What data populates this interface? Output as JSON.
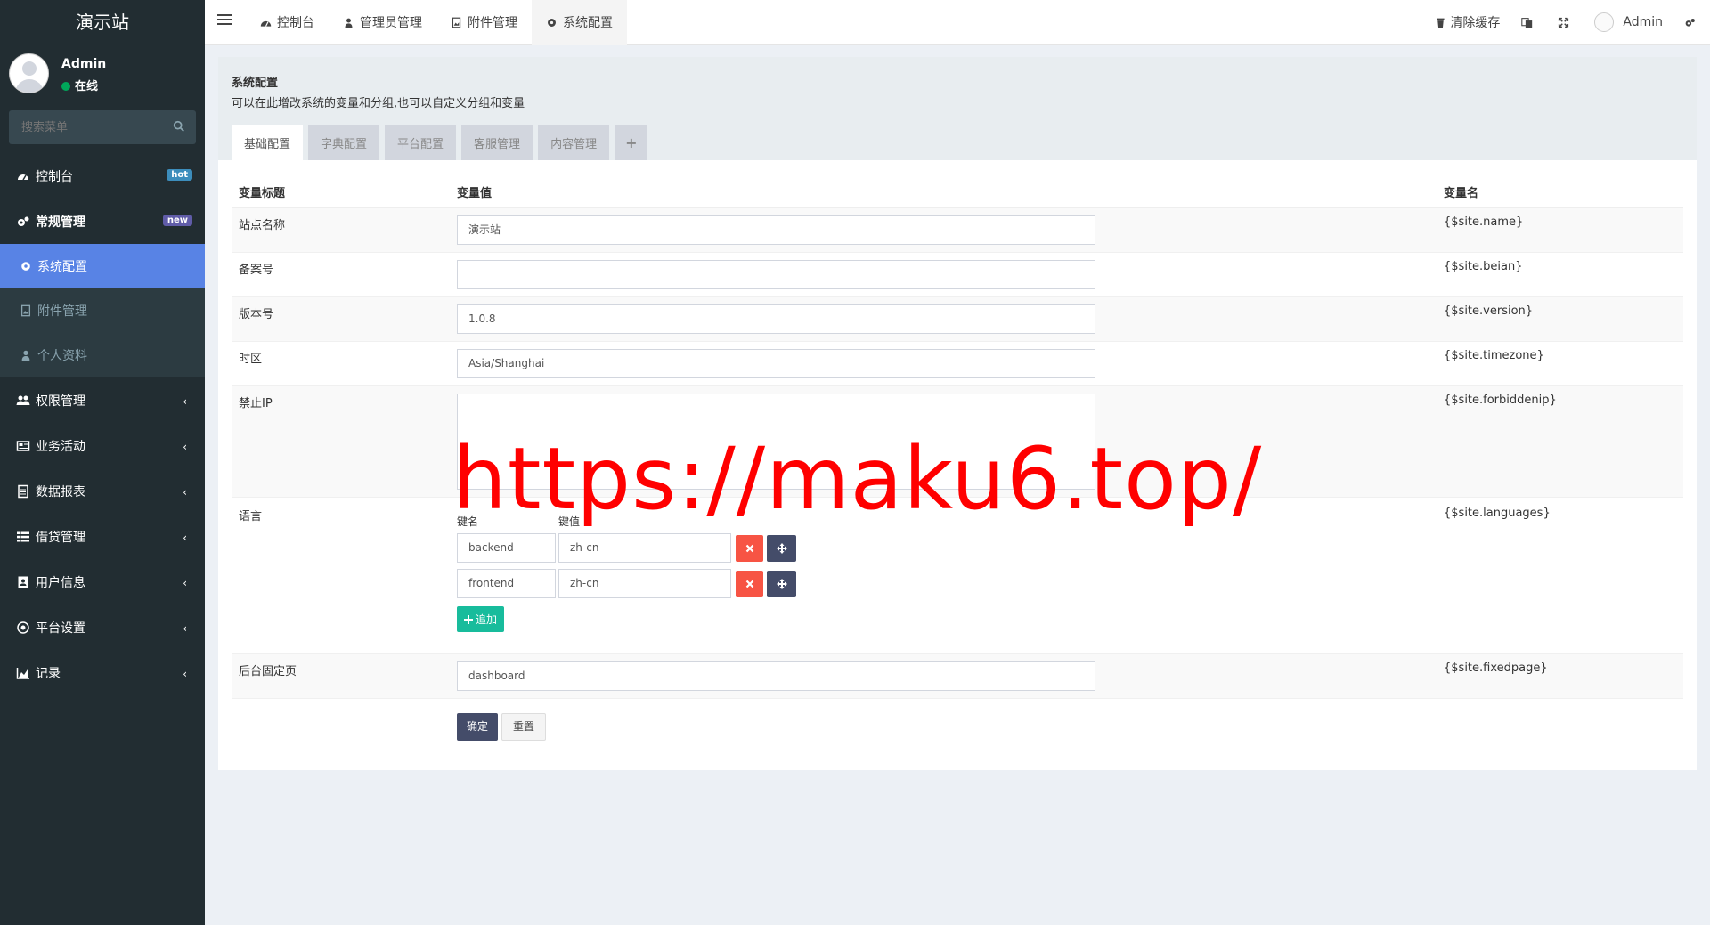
{
  "sidebar": {
    "logo": "演示站",
    "user": {
      "name": "Admin",
      "status": "在线"
    },
    "search": {
      "placeholder": "搜索菜单"
    },
    "menu": [
      {
        "label": "控制台",
        "badge": "hot"
      },
      {
        "label": "常规管理",
        "badge": "new"
      },
      {
        "label": "权限管理",
        "chevron": "‹"
      },
      {
        "label": "业务活动",
        "chevron": "‹"
      },
      {
        "label": "数据报表",
        "chevron": "‹"
      },
      {
        "label": "借贷管理",
        "chevron": "‹"
      },
      {
        "label": "用户信息",
        "chevron": "‹"
      },
      {
        "label": "平台设置",
        "chevron": "‹"
      },
      {
        "label": "记录",
        "chevron": "‹"
      }
    ],
    "submenu": [
      {
        "label": "系统配置"
      },
      {
        "label": "附件管理"
      },
      {
        "label": "个人资料"
      }
    ]
  },
  "topnav": {
    "tabs": [
      {
        "label": "控制台"
      },
      {
        "label": "管理员管理"
      },
      {
        "label": "附件管理"
      },
      {
        "label": "系统配置"
      }
    ],
    "clear_cache": "清除缓存",
    "admin": "Admin"
  },
  "panel": {
    "title": "系统配置",
    "description": "可以在此增改系统的变量和分组,也可以自定义分组和变量",
    "tabs": [
      "基础配置",
      "字典配置",
      "平台配置",
      "客服管理",
      "内容管理",
      "+"
    ]
  },
  "table": {
    "headers": {
      "title": "变量标题",
      "value": "变量值",
      "name": "变量名"
    },
    "rows": [
      {
        "title": "站点名称",
        "value": "演示站",
        "name": "{$site.name}"
      },
      {
        "title": "备案号",
        "value": "",
        "name": "{$site.beian}"
      },
      {
        "title": "版本号",
        "value": "1.0.8",
        "name": "{$site.version}"
      },
      {
        "title": "时区",
        "value": "Asia/Shanghai",
        "name": "{$site.timezone}"
      },
      {
        "title": "禁止IP",
        "value": "",
        "name": "{$site.forbiddenip}"
      },
      {
        "title": "语言",
        "name": "{$site.languages}"
      },
      {
        "title": "后台固定页",
        "value": "dashboard",
        "name": "{$site.fixedpage}"
      }
    ],
    "languages": {
      "key_header": "键名",
      "value_header": "键值",
      "items": [
        {
          "key": "backend",
          "value": "zh-cn"
        },
        {
          "key": "frontend",
          "value": "zh-cn"
        }
      ],
      "add_label": "追加"
    }
  },
  "buttons": {
    "submit": "确定",
    "reset": "重置"
  },
  "watermark": "https://maku6.top/",
  "colors": {
    "sidebar": "#222d32",
    "active_menu": "#5883e5",
    "danger": "#f75444",
    "success": "#18bc9c",
    "primary": "#444c69"
  }
}
